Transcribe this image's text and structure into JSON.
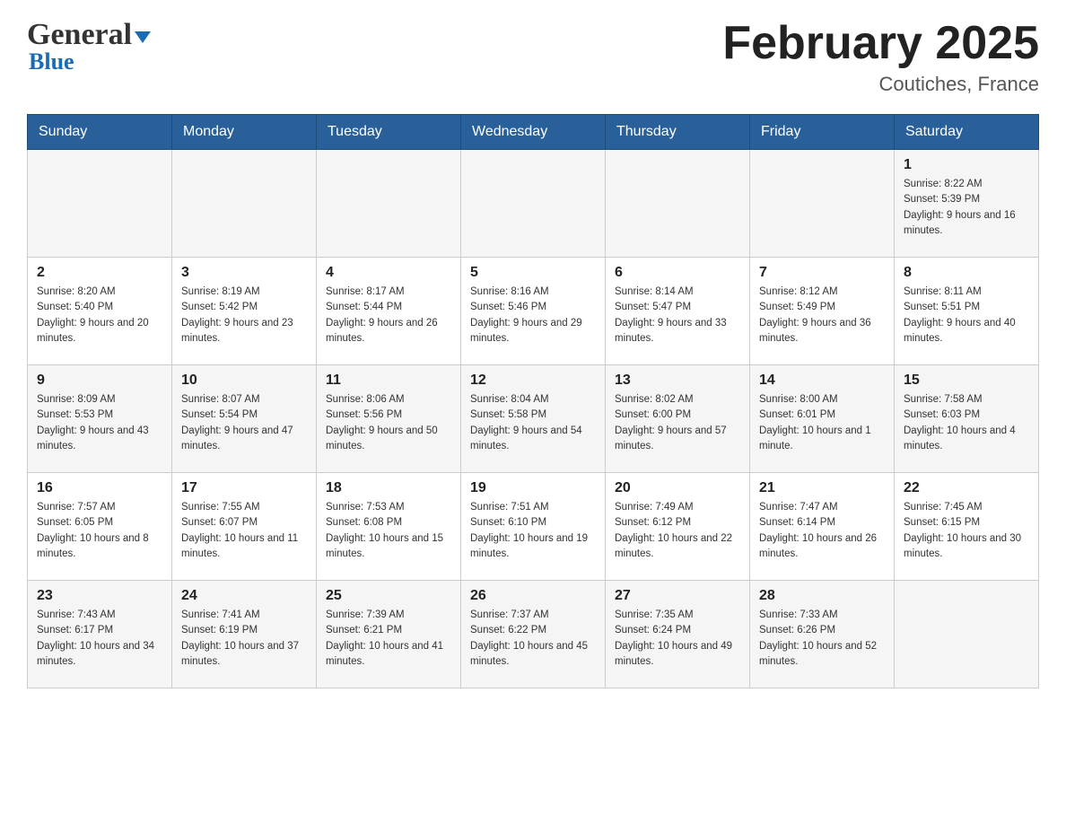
{
  "header": {
    "logo_line1": "General",
    "logo_triangle": "▼",
    "logo_line2": "Blue",
    "month_title": "February 2025",
    "location": "Coutiches, France"
  },
  "days_of_week": [
    "Sunday",
    "Monday",
    "Tuesday",
    "Wednesday",
    "Thursday",
    "Friday",
    "Saturday"
  ],
  "weeks": [
    [
      {
        "day": "",
        "info": ""
      },
      {
        "day": "",
        "info": ""
      },
      {
        "day": "",
        "info": ""
      },
      {
        "day": "",
        "info": ""
      },
      {
        "day": "",
        "info": ""
      },
      {
        "day": "",
        "info": ""
      },
      {
        "day": "1",
        "info": "Sunrise: 8:22 AM\nSunset: 5:39 PM\nDaylight: 9 hours and 16 minutes."
      }
    ],
    [
      {
        "day": "2",
        "info": "Sunrise: 8:20 AM\nSunset: 5:40 PM\nDaylight: 9 hours and 20 minutes."
      },
      {
        "day": "3",
        "info": "Sunrise: 8:19 AM\nSunset: 5:42 PM\nDaylight: 9 hours and 23 minutes."
      },
      {
        "day": "4",
        "info": "Sunrise: 8:17 AM\nSunset: 5:44 PM\nDaylight: 9 hours and 26 minutes."
      },
      {
        "day": "5",
        "info": "Sunrise: 8:16 AM\nSunset: 5:46 PM\nDaylight: 9 hours and 29 minutes."
      },
      {
        "day": "6",
        "info": "Sunrise: 8:14 AM\nSunset: 5:47 PM\nDaylight: 9 hours and 33 minutes."
      },
      {
        "day": "7",
        "info": "Sunrise: 8:12 AM\nSunset: 5:49 PM\nDaylight: 9 hours and 36 minutes."
      },
      {
        "day": "8",
        "info": "Sunrise: 8:11 AM\nSunset: 5:51 PM\nDaylight: 9 hours and 40 minutes."
      }
    ],
    [
      {
        "day": "9",
        "info": "Sunrise: 8:09 AM\nSunset: 5:53 PM\nDaylight: 9 hours and 43 minutes."
      },
      {
        "day": "10",
        "info": "Sunrise: 8:07 AM\nSunset: 5:54 PM\nDaylight: 9 hours and 47 minutes."
      },
      {
        "day": "11",
        "info": "Sunrise: 8:06 AM\nSunset: 5:56 PM\nDaylight: 9 hours and 50 minutes."
      },
      {
        "day": "12",
        "info": "Sunrise: 8:04 AM\nSunset: 5:58 PM\nDaylight: 9 hours and 54 minutes."
      },
      {
        "day": "13",
        "info": "Sunrise: 8:02 AM\nSunset: 6:00 PM\nDaylight: 9 hours and 57 minutes."
      },
      {
        "day": "14",
        "info": "Sunrise: 8:00 AM\nSunset: 6:01 PM\nDaylight: 10 hours and 1 minute."
      },
      {
        "day": "15",
        "info": "Sunrise: 7:58 AM\nSunset: 6:03 PM\nDaylight: 10 hours and 4 minutes."
      }
    ],
    [
      {
        "day": "16",
        "info": "Sunrise: 7:57 AM\nSunset: 6:05 PM\nDaylight: 10 hours and 8 minutes."
      },
      {
        "day": "17",
        "info": "Sunrise: 7:55 AM\nSunset: 6:07 PM\nDaylight: 10 hours and 11 minutes."
      },
      {
        "day": "18",
        "info": "Sunrise: 7:53 AM\nSunset: 6:08 PM\nDaylight: 10 hours and 15 minutes."
      },
      {
        "day": "19",
        "info": "Sunrise: 7:51 AM\nSunset: 6:10 PM\nDaylight: 10 hours and 19 minutes."
      },
      {
        "day": "20",
        "info": "Sunrise: 7:49 AM\nSunset: 6:12 PM\nDaylight: 10 hours and 22 minutes."
      },
      {
        "day": "21",
        "info": "Sunrise: 7:47 AM\nSunset: 6:14 PM\nDaylight: 10 hours and 26 minutes."
      },
      {
        "day": "22",
        "info": "Sunrise: 7:45 AM\nSunset: 6:15 PM\nDaylight: 10 hours and 30 minutes."
      }
    ],
    [
      {
        "day": "23",
        "info": "Sunrise: 7:43 AM\nSunset: 6:17 PM\nDaylight: 10 hours and 34 minutes."
      },
      {
        "day": "24",
        "info": "Sunrise: 7:41 AM\nSunset: 6:19 PM\nDaylight: 10 hours and 37 minutes."
      },
      {
        "day": "25",
        "info": "Sunrise: 7:39 AM\nSunset: 6:21 PM\nDaylight: 10 hours and 41 minutes."
      },
      {
        "day": "26",
        "info": "Sunrise: 7:37 AM\nSunset: 6:22 PM\nDaylight: 10 hours and 45 minutes."
      },
      {
        "day": "27",
        "info": "Sunrise: 7:35 AM\nSunset: 6:24 PM\nDaylight: 10 hours and 49 minutes."
      },
      {
        "day": "28",
        "info": "Sunrise: 7:33 AM\nSunset: 6:26 PM\nDaylight: 10 hours and 52 minutes."
      },
      {
        "day": "",
        "info": ""
      }
    ]
  ]
}
